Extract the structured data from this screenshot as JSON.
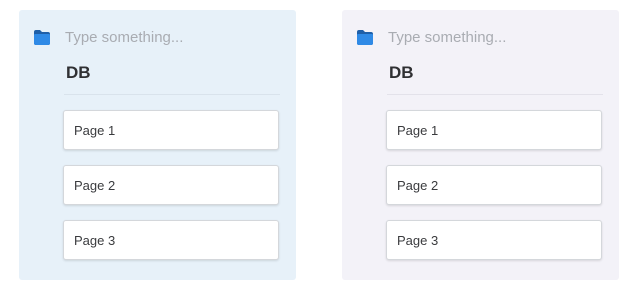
{
  "colors": {
    "left_panel_bg": "#e7f1f9",
    "right_panel_bg": "#f3f2f8",
    "folder_icon_blue": "#2f8ae6",
    "folder_icon_dark": "#1e5fa8",
    "divider_left": "#d9e3ec",
    "divider_right": "#e3e2ea"
  },
  "panels": [
    {
      "icon": "folder-icon",
      "placeholder": "Type something...",
      "title": "DB",
      "pages": [
        {
          "label": "Page 1"
        },
        {
          "label": "Page 2"
        },
        {
          "label": "Page 3"
        }
      ]
    },
    {
      "icon": "folder-icon",
      "placeholder": "Type something...",
      "title": "DB",
      "pages": [
        {
          "label": "Page 1"
        },
        {
          "label": "Page 2"
        },
        {
          "label": "Page 3"
        }
      ]
    }
  ]
}
